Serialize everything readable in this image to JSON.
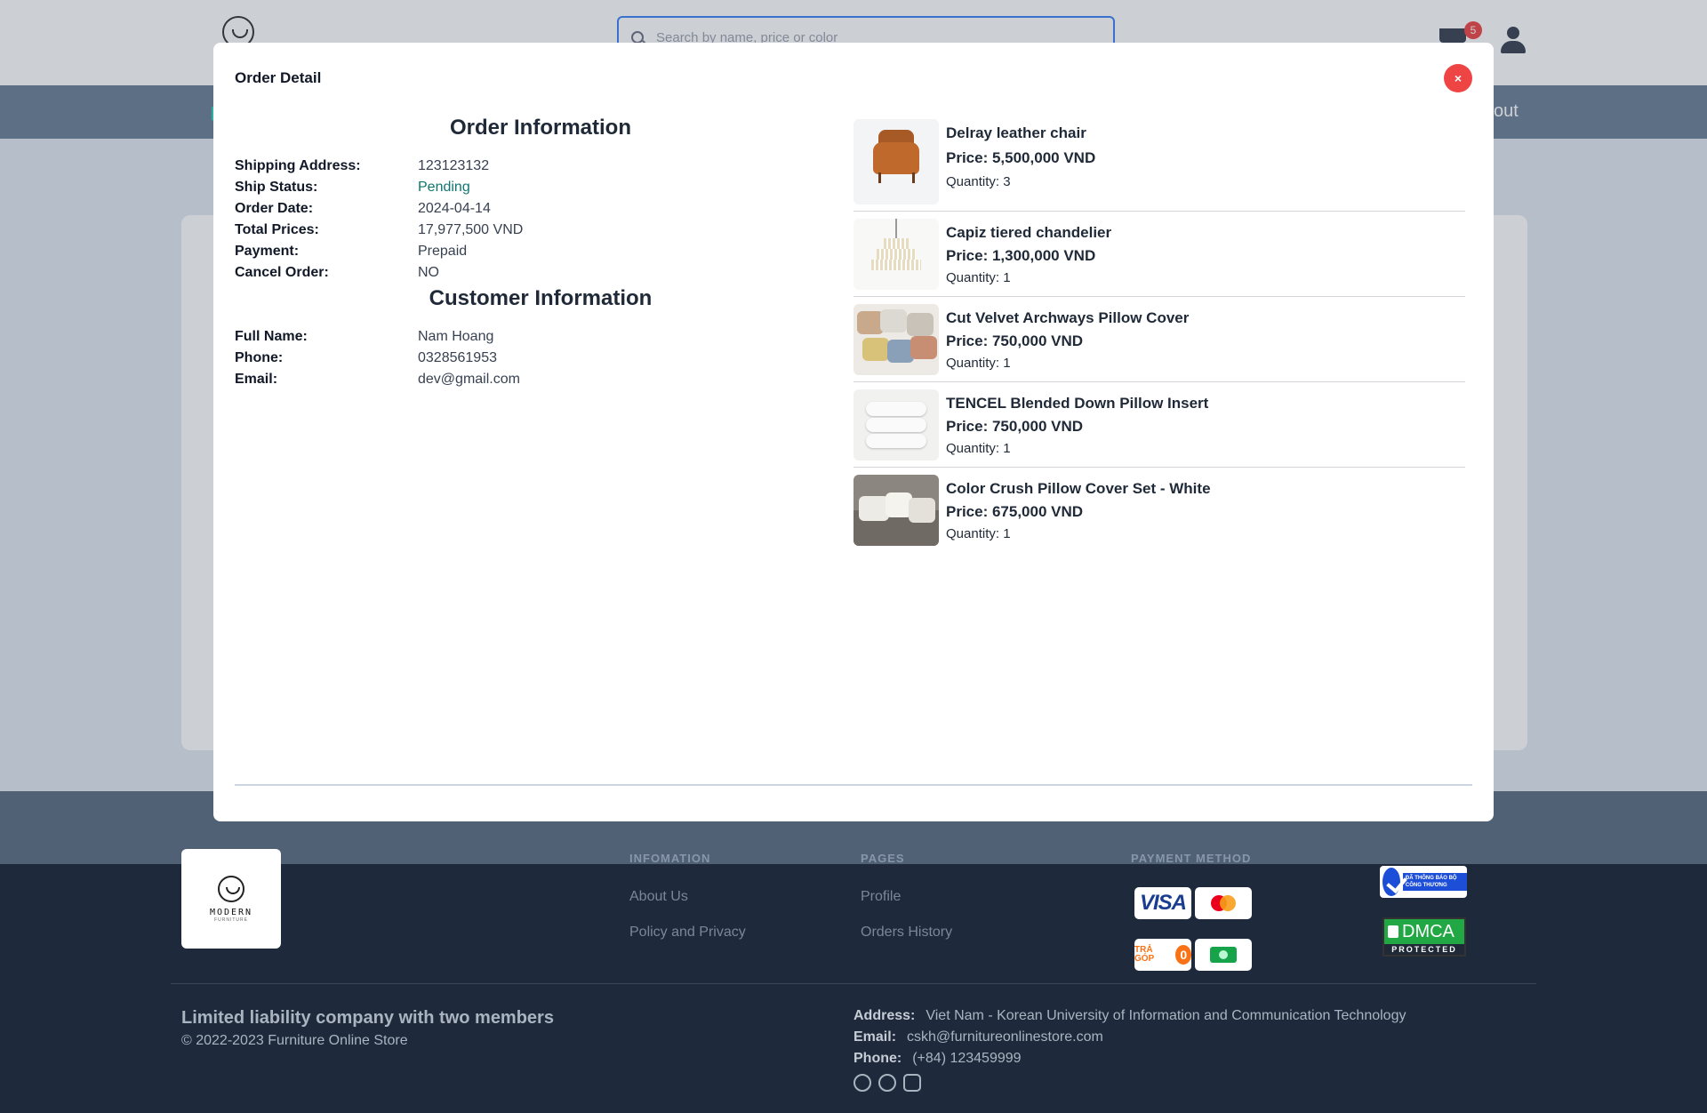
{
  "header": {
    "search_placeholder": "Search by name, price or color",
    "cart_count": "5"
  },
  "navbar": {
    "right_fragment": "out"
  },
  "modal": {
    "title": "Order Detail",
    "close_label": "×",
    "order_info": {
      "heading": "Order Information",
      "rows": [
        {
          "label": "Shipping Address:",
          "value": "123123132"
        },
        {
          "label": "Ship Status:",
          "value": "Pending"
        },
        {
          "label": "Order Date:",
          "value": "2024-04-14"
        },
        {
          "label": "Total Prices:",
          "value": "17,977,500 VND"
        },
        {
          "label": "Payment:",
          "value": "Prepaid"
        },
        {
          "label": "Cancel Order:",
          "value": "NO"
        }
      ]
    },
    "customer_info": {
      "heading": "Customer Information",
      "rows": [
        {
          "label": "Full Name:",
          "value": "Nam Hoang"
        },
        {
          "label": "Phone:",
          "value": "0328561953"
        },
        {
          "label": "Email:",
          "value": "dev@gmail.com"
        }
      ]
    },
    "products": [
      {
        "name": "Delray leather chair",
        "price": "Price: 5,500,000 VND",
        "quantity": "Quantity: 3"
      },
      {
        "name": "Capiz tiered chandelier",
        "price": "Price: 1,300,000 VND",
        "quantity": "Quantity: 1"
      },
      {
        "name": "Cut Velvet Archways Pillow Cover",
        "price": "Price: 750,000 VND",
        "quantity": "Quantity: 1"
      },
      {
        "name": "TENCEL Blended Down Pillow Insert",
        "price": "Price: 750,000 VND",
        "quantity": "Quantity: 1"
      },
      {
        "name": "Color Crush Pillow Cover Set - White",
        "price": "Price: 675,000 VND",
        "quantity": "Quantity: 1"
      }
    ]
  },
  "footer": {
    "logo_brand": "MODERN",
    "logo_sub": "FURNITURE",
    "information_heading": "INFOMATION",
    "information_links": [
      "About Us",
      "Policy and Privacy"
    ],
    "pages_heading": "PAGES",
    "pages_links": [
      "Profile",
      "Orders History"
    ],
    "payment_heading": "PAYMENT METHOD",
    "payment_visa": "VISA",
    "payment_tragop": "TRẢ GÓP",
    "payment_tragop_zero": "0",
    "badge_notice": "ĐÃ THÔNG BÁO BỘ CÔNG THƯƠNG",
    "badge_dmca": "DMCA",
    "badge_dmca_sub": "PROTECTED",
    "company": "Limited liability company with two members",
    "copyright": "© 2022-2023 Furniture Online Store",
    "address_label": "Address:",
    "address": "Viet Nam - Korean University of Information and Communication Technology",
    "email_label": "Email:",
    "email": "cskh@furnitureonlinestore.com",
    "phone_label": "Phone:",
    "phone": "(+84) 123459999"
  }
}
